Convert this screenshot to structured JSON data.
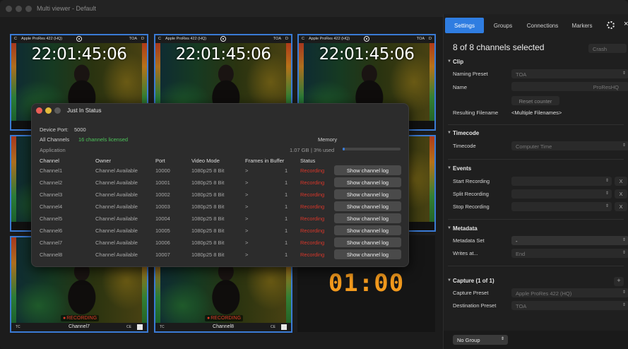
{
  "window": {
    "title": "Multi viewer - Default"
  },
  "tiles": [
    {
      "channel_tag": "C",
      "format": "Apple ProRes 422 (HQ)",
      "toa": "TOA",
      "dd": "D",
      "timecode": "22:01:45:06"
    },
    {
      "channel_tag": "C",
      "format": "Apple ProRes 422 (HQ)",
      "toa": "TOA",
      "dd": "D",
      "timecode": "22:01:45:06"
    },
    {
      "channel_tag": "C",
      "format": "Apple ProRes 422 (HQ)",
      "toa": "TOA",
      "dd": "D",
      "timecode": "22:01:45:06"
    },
    {
      "tc_tag": "TC",
      "name": "Channel7",
      "ce": "CE",
      "recording": "RECORDING"
    },
    {
      "tc_tag": "TC",
      "name": "Channel8",
      "ce": "CE",
      "recording": "RECORDING"
    }
  ],
  "clock": "01:00",
  "dialog": {
    "title": "Just In Status",
    "device_port_label": "Device Port:",
    "device_port_value": "5000",
    "all_channels_label": "All Channels",
    "licensed": "16 channels licensed",
    "application_label": "Application",
    "memory_label": "Memory",
    "memory_value": "1.07 GB",
    "memory_used": "| 3% used",
    "memory_fraction": 0.03,
    "headers": [
      "Channel",
      "Owner",
      "Port",
      "Video Mode",
      "Frames in Buffer",
      "Status"
    ],
    "rows": [
      {
        "channel": "Channel1",
        "owner": "Channel Available",
        "port": "10000",
        "mode": "1080p25 8 Bit",
        "arrow": ">",
        "frames": "1",
        "status": "Recording",
        "button": "Show channel log"
      },
      {
        "channel": "Channel2",
        "owner": "Channel Available",
        "port": "10001",
        "mode": "1080p25 8 Bit",
        "arrow": ">",
        "frames": "1",
        "status": "Recording",
        "button": "Show channel log"
      },
      {
        "channel": "Channel3",
        "owner": "Channel Available",
        "port": "10002",
        "mode": "1080p25 8 Bit",
        "arrow": ">",
        "frames": "1",
        "status": "Recording",
        "button": "Show channel log"
      },
      {
        "channel": "Channel4",
        "owner": "Channel Available",
        "port": "10003",
        "mode": "1080p25 8 Bit",
        "arrow": ">",
        "frames": "1",
        "status": "Recording",
        "button": "Show channel log"
      },
      {
        "channel": "Channel5",
        "owner": "Channel Available",
        "port": "10004",
        "mode": "1080p25 8 Bit",
        "arrow": ">",
        "frames": "1",
        "status": "Recording",
        "button": "Show channel log"
      },
      {
        "channel": "Channel6",
        "owner": "Channel Available",
        "port": "10005",
        "mode": "1080p25 8 Bit",
        "arrow": ">",
        "frames": "1",
        "status": "Recording",
        "button": "Show channel log"
      },
      {
        "channel": "Channel7",
        "owner": "Channel Available",
        "port": "10006",
        "mode": "1080p25 8 Bit",
        "arrow": ">",
        "frames": "1",
        "status": "Recording",
        "button": "Show channel log"
      },
      {
        "channel": "Channel8",
        "owner": "Channel Available",
        "port": "10007",
        "mode": "1080p25 8 Bit",
        "arrow": ">",
        "frames": "1",
        "status": "Recording",
        "button": "Show channel log"
      }
    ]
  },
  "settings": {
    "tabs": [
      "Settings",
      "Groups",
      "Connections",
      "Markers"
    ],
    "selection": "8 of 8 channels selected",
    "crash": "Crash",
    "clip": {
      "header": "Clip",
      "naming_preset_label": "Naming Preset",
      "naming_preset_value": "TOA",
      "name_label": "Name",
      "name_suffix": "ProResHQ",
      "reset_counter": "Reset counter",
      "resulting_label": "Resulting Filename",
      "resulting_value": "<Multiple Filenames>"
    },
    "timecode": {
      "header": "Timecode",
      "label": "Timecode",
      "value": "Computer Time"
    },
    "events": {
      "header": "Events",
      "start": "Start Recording",
      "split": "Split Recording",
      "stop": "Stop Recording",
      "clear": "X"
    },
    "metadata": {
      "header": "Metadata",
      "set_label": "Metadata Set",
      "set_value": "-",
      "writes_label": "Writes at...",
      "writes_value": "End"
    },
    "capture": {
      "header": "Capture (1 of 1)",
      "add": "+",
      "capture_preset_label": "Capture Preset",
      "capture_preset_value": "Apple ProRes 422 (HQ)",
      "dest_preset_label": "Destination Preset",
      "dest_preset_value": "TOA"
    },
    "group_select": "No Group"
  },
  "colors": {
    "accent": "#2f7de1",
    "recording": "#d8362a",
    "clock": "#f39a1d",
    "licensed": "#4cc45a",
    "tile_border": "#3a7bd5"
  }
}
